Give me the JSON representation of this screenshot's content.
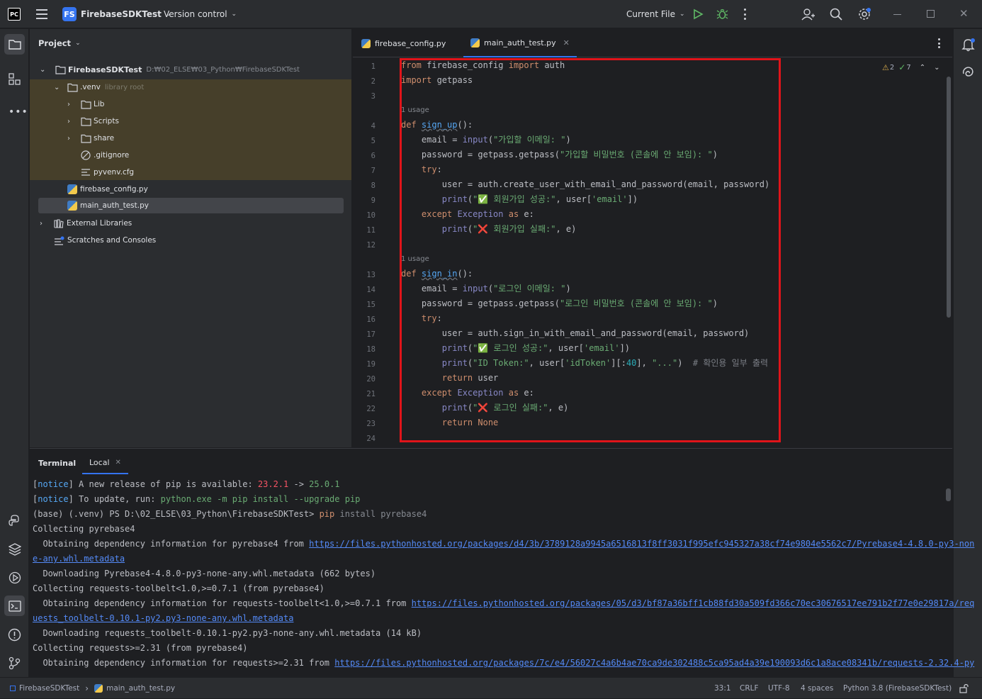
{
  "titlebar": {
    "app_logo": "PC",
    "project_badge": "FS",
    "project_name": "FirebaseSDKTest",
    "vcs": "Version control",
    "run_config": "Current File"
  },
  "project_panel": {
    "title": "Project",
    "root": {
      "name": "FirebaseSDKTest",
      "path": "D:₩02_ELSE₩03_Python₩FirebaseSDKTest"
    },
    "venv": {
      "name": ".venv",
      "hint": "library root"
    },
    "items": [
      "Lib",
      "Scripts",
      "share",
      ".gitignore",
      "pyvenv.cfg"
    ],
    "files": [
      "firebase_config.py",
      "main_auth_test.py"
    ],
    "external": "External Libraries",
    "scratches": "Scratches and Consoles"
  },
  "editor": {
    "tabs": [
      "firebase_config.py",
      "main_auth_test.py"
    ],
    "warnings": "2",
    "checks": "7",
    "usage_hint": "1 usage",
    "line_numbers": [
      "1",
      "2",
      "3",
      "4",
      "5",
      "6",
      "7",
      "8",
      "9",
      "10",
      "11",
      "12",
      "13",
      "14",
      "15",
      "16",
      "17",
      "18",
      "19",
      "20",
      "21",
      "22",
      "23",
      "24"
    ]
  },
  "code": {
    "l1": {
      "a": "from",
      "b": " firebase_config ",
      "c": "import",
      "d": " auth"
    },
    "l2": {
      "a": "import",
      "b": " getpass"
    },
    "l4": {
      "a": "def ",
      "b": "sign_up",
      "c": "():"
    },
    "l5": {
      "a": "    email = ",
      "b": "input",
      "c": "(",
      "d": "\"가입할 이메일: \"",
      "e": ")"
    },
    "l6": {
      "a": "    password = getpass.getpass(",
      "b": "\"가입할 비밀번호 (콘솔에 안 보임): \"",
      "c": ")"
    },
    "l7": {
      "a": "    try",
      "b": ":"
    },
    "l8": "        user = auth.create_user_with_email_and_password(email, password)",
    "l9": {
      "a": "        ",
      "b": "print",
      "c": "(",
      "d": "\"✅ 회원가입 성공:\"",
      "e": ", user[",
      "f": "'email'",
      "g": "])"
    },
    "l10": {
      "a": "    except ",
      "b": "Exception",
      "c": " as",
      "d": " e:"
    },
    "l11": {
      "a": "        ",
      "b": "print",
      "c": "(",
      "d": "\"❌ 회원가입 실패:\"",
      "e": ", e)"
    },
    "l13": {
      "a": "def ",
      "b": "sign_in",
      "c": "():"
    },
    "l14": {
      "a": "    email = ",
      "b": "input",
      "c": "(",
      "d": "\"로그인 이메일: \"",
      "e": ")"
    },
    "l15": {
      "a": "    password = getpass.getpass(",
      "b": "\"로그인 비밀번호 (콘솔에 안 보임): \"",
      "c": ")"
    },
    "l16": {
      "a": "    try",
      "b": ":"
    },
    "l17": "        user = auth.sign_in_with_email_and_password(email, password)",
    "l18": {
      "a": "        ",
      "b": "print",
      "c": "(",
      "d": "\"✅ 로그인 성공:\"",
      "e": ", user[",
      "f": "'email'",
      "g": "])"
    },
    "l19": {
      "a": "        ",
      "b": "print",
      "c": "(",
      "d": "\"ID Token:\"",
      "e": ", user[",
      "f": "'idToken'",
      "g": "][:",
      "h": "40",
      "i": "], ",
      "j": "\"...\"",
      "k": ")  ",
      "l": "# 확인용 일부 출력"
    },
    "l20": {
      "a": "        return",
      "b": " user"
    },
    "l21": {
      "a": "    except ",
      "b": "Exception",
      "c": " as",
      "d": " e:"
    },
    "l22": {
      "a": "        ",
      "b": "print",
      "c": "(",
      "d": "\"❌ 로그인 실패:\"",
      "e": ", e)"
    },
    "l23": {
      "a": "        return",
      "b": " None"
    }
  },
  "terminal": {
    "tab_title": "Terminal",
    "session": "Local",
    "t1": {
      "a": "[",
      "b": "notice",
      "c": "] A new release of pip is available: ",
      "d": "23.2.1",
      "e": " -> ",
      "f": "25.0.1"
    },
    "t2": {
      "a": "[",
      "b": "notice",
      "c": "] To update, run: ",
      "d": "python.exe -m pip install --upgrade pip"
    },
    "t3": {
      "a": "(base) (.venv) PS D:\\02_ELSE\\03_Python\\FirebaseSDKTest> ",
      "b": "pip",
      "c": " install pyrebase4"
    },
    "t4": "Collecting pyrebase4",
    "t5": {
      "a": "  Obtaining dependency information for pyrebase4 from ",
      "b": "https://files.pythonhosted.org/packages/d4/3b/3789128a9945a6516813f8ff3031f995efc945327a38cf74e9804e5562c7/Pyrebase4-4.8.0-py3-non"
    },
    "t6": "e-any.whl.metadata",
    "t7": "  Downloading Pyrebase4-4.8.0-py3-none-any.whl.metadata (662 bytes)",
    "t8": "Collecting requests-toolbelt<1.0,>=0.7.1 (from pyrebase4)",
    "t9": {
      "a": "  Obtaining dependency information for requests-toolbelt<1.0,>=0.7.1 from ",
      "b": "https://files.pythonhosted.org/packages/05/d3/bf87a36bff1cb88fd30a509fd366c70ec30676517ee791b2f77e0e29817a/req"
    },
    "t10": "uests_toolbelt-0.10.1-py2.py3-none-any.whl.metadata",
    "t11": "  Downloading requests_toolbelt-0.10.1-py2.py3-none-any.whl.metadata (14 kB)",
    "t12": "Collecting requests>=2.31 (from pyrebase4)",
    "t13": {
      "a": "  Obtaining dependency information for requests>=2.31 from ",
      "b": "https://files.pythonhosted.org/packages/7c/e4/56027c4a6b4ae70ca9de302488c5ca95ad4a39e190093d6c1a8ace08341b/requests-2.32.4-py"
    }
  },
  "status_bar": {
    "breadcrumb_project": "FirebaseSDKTest",
    "breadcrumb_file": "main_auth_test.py",
    "position": "33:1",
    "line_sep": "CRLF",
    "encoding": "UTF-8",
    "indent": "4 spaces",
    "interpreter": "Python 3.8 (FirebaseSDKTest)"
  }
}
